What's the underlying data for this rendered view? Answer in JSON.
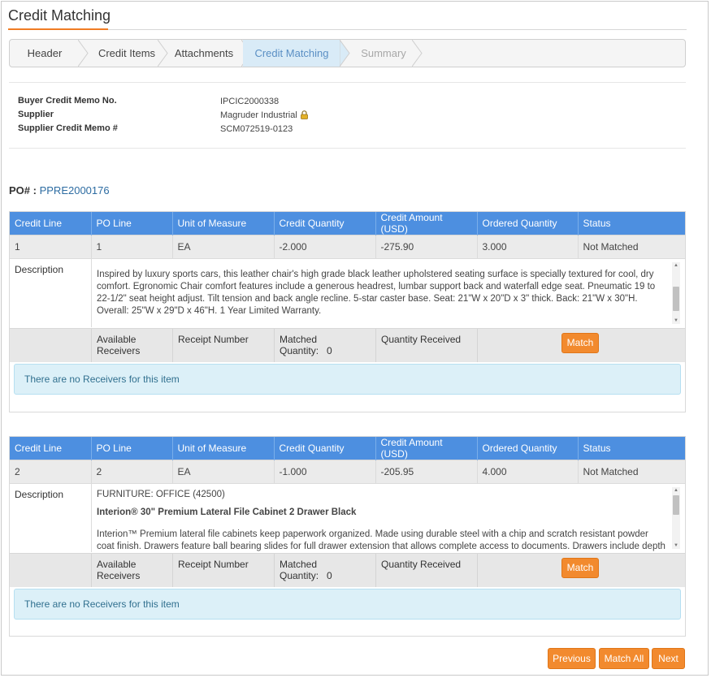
{
  "page": {
    "title": "Credit Matching"
  },
  "wizard": {
    "steps": [
      {
        "label": "Header",
        "state": "done"
      },
      {
        "label": "Credit Items",
        "state": "done"
      },
      {
        "label": "Attachments",
        "state": "done"
      },
      {
        "label": "Credit Matching",
        "state": "active"
      },
      {
        "label": "Summary",
        "state": "disabled"
      }
    ]
  },
  "info": {
    "buyer_memo_label": "Buyer Credit Memo No.",
    "buyer_memo_value": "IPCIC2000338",
    "supplier_label": "Supplier",
    "supplier_value": "Magruder Industrial",
    "supplier_memo_label": "Supplier Credit Memo #",
    "supplier_memo_value": "SCM072519-0123"
  },
  "po": {
    "label": "PO# :",
    "number": "PPRE2000176"
  },
  "columns": [
    "Credit Line",
    "PO Line",
    "Unit of Measure",
    "Credit Quantity",
    "Credit Amount (USD)",
    "Ordered Quantity",
    "Status"
  ],
  "lines": [
    {
      "credit_line": "1",
      "po_line": "1",
      "uom": "EA",
      "credit_quantity": "-2.000",
      "credit_amount": "-275.90",
      "ordered_quantity": "3.000",
      "status": "Not Matched",
      "description_label": "Description",
      "description_text": "Inspired by luxury sports cars, this leather chair's high grade black leather upholstered seating surface is specially textured for cool, dry comfort. Egronomic Chair comfort features include a generous headrest, lumbar support back and waterfall edge seat. Pneumatic 19 to 22-1/2\" seat height adjust. Tilt tension and back angle recline. 5-star caster base. Seat: 21\"W x 20\"D x 3\" thick. Back: 21\"W x 30\"H. Overall: 25\"W x 29\"D x 46\"H. 1 Year Limited Warranty.",
      "available_receivers_label": "Available Receivers",
      "receipt_number_label": "Receipt Number",
      "matched_quantity_label": "Matched Quantity:",
      "matched_quantity_value": "0",
      "quantity_received_label": "Quantity Received",
      "match_label": "Match",
      "empty_message": "There are no Receivers for this item"
    },
    {
      "credit_line": "2",
      "po_line": "2",
      "uom": "EA",
      "credit_quantity": "-1.000",
      "credit_amount": "-205.95",
      "ordered_quantity": "4.000",
      "status": "Not Matched",
      "description_label": "Description",
      "description_category": "FURNITURE: OFFICE (42500)",
      "description_name": "Interion® 30\" Premium Lateral File Cabinet 2 Drawer Black",
      "description_text": "Interion™ Premium lateral file cabinets keep paperwork organized. Made using durable steel with a chip and scratch resistant powder coat finish. Drawers feature ball bearing slides for full drawer extension that allows complete access to documents. Drawers include depth adjustable hang rails",
      "available_receivers_label": "Available Receivers",
      "receipt_number_label": "Receipt Number",
      "matched_quantity_label": "Matched Quantity:",
      "matched_quantity_value": "0",
      "quantity_received_label": "Quantity Received",
      "match_label": "Match",
      "empty_message": "There are no Receivers for this item"
    }
  ],
  "footer": {
    "previous_label": "Previous",
    "match_all_label": "Match All",
    "next_label": "Next"
  },
  "colors": {
    "accent": "#f28a2e",
    "header_blue": "#4d8fe0",
    "active_step": "#d9ebf7",
    "link": "#2d6ca2",
    "info_bg": "#dcf0f8"
  }
}
